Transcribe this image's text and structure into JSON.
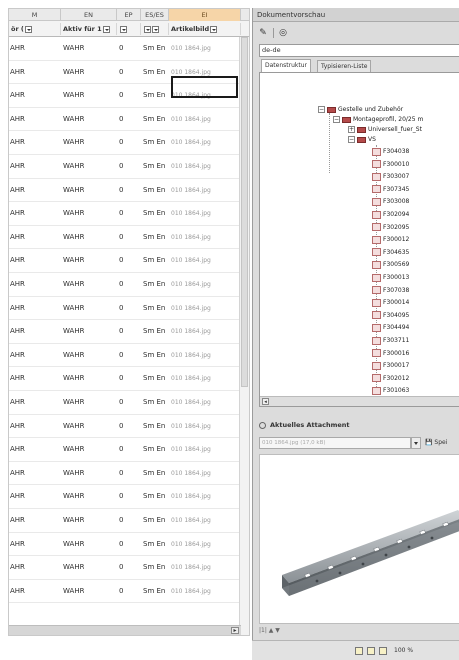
{
  "grid": {
    "header_row1": [
      "M",
      "EN",
      "EP",
      "ES/ES",
      "EI"
    ],
    "header_row2": [
      "ör (",
      "Aktiv für 1",
      "",
      "",
      "Artikelbild"
    ],
    "rows": [
      {
        "c1": "AHR",
        "c2": "WAHR",
        "c3": "0",
        "c4": "Sm En",
        "c5": "010 1864.jpg"
      },
      {
        "c1": "AHR",
        "c2": "WAHR",
        "c3": "0",
        "c4": "Sm En",
        "c5": "010 1864.jpg"
      },
      {
        "c1": "AHR",
        "c2": "WAHR",
        "c3": "0",
        "c4": "Sm En",
        "c5": "010 1864.jpg"
      },
      {
        "c1": "AHR",
        "c2": "WAHR",
        "c3": "0",
        "c4": "Sm En",
        "c5": "010 1864.jpg"
      },
      {
        "c1": "AHR",
        "c2": "WAHR",
        "c3": "0",
        "c4": "Sm En",
        "c5": "010 1864.jpg"
      },
      {
        "c1": "AHR",
        "c2": "WAHR",
        "c3": "0",
        "c4": "Sm En",
        "c5": "010 1864.jpg"
      },
      {
        "c1": "AHR",
        "c2": "WAHR",
        "c3": "0",
        "c4": "Sm En",
        "c5": "010 1864.jpg"
      },
      {
        "c1": "AHR",
        "c2": "WAHR",
        "c3": "0",
        "c4": "Sm En",
        "c5": "010 1864.jpg"
      },
      {
        "c1": "AHR",
        "c2": "WAHR",
        "c3": "0",
        "c4": "Sm En",
        "c5": "010 1864.jpg"
      },
      {
        "c1": "AHR",
        "c2": "WAHR",
        "c3": "0",
        "c4": "Sm En",
        "c5": "010 1864.jpg"
      },
      {
        "c1": "AHR",
        "c2": "WAHR",
        "c3": "0",
        "c4": "Sm En",
        "c5": "010 1864.jpg"
      },
      {
        "c1": "AHR",
        "c2": "WAHR",
        "c3": "0",
        "c4": "Sm En",
        "c5": "010 1864.jpg"
      },
      {
        "c1": "AHR",
        "c2": "WAHR",
        "c3": "0",
        "c4": "Sm En",
        "c5": "010 1864.jpg"
      },
      {
        "c1": "AHR",
        "c2": "WAHR",
        "c3": "0",
        "c4": "Sm En",
        "c5": "010 1864.jpg"
      },
      {
        "c1": "AHR",
        "c2": "WAHR",
        "c3": "0",
        "c4": "Sm En",
        "c5": "010 1864.jpg"
      },
      {
        "c1": "AHR",
        "c2": "WAHR",
        "c3": "0",
        "c4": "Sm En",
        "c5": "010 1864.jpg"
      },
      {
        "c1": "AHR",
        "c2": "WAHR",
        "c3": "0",
        "c4": "Sm En",
        "c5": "010 1864.jpg"
      },
      {
        "c1": "AHR",
        "c2": "WAHR",
        "c3": "0",
        "c4": "Sm En",
        "c5": "010 1864.jpg"
      },
      {
        "c1": "AHR",
        "c2": "WAHR",
        "c3": "0",
        "c4": "Sm En",
        "c5": "010 1864.jpg"
      },
      {
        "c1": "AHR",
        "c2": "WAHR",
        "c3": "0",
        "c4": "Sm En",
        "c5": "010 1864.jpg"
      },
      {
        "c1": "AHR",
        "c2": "WAHR",
        "c3": "0",
        "c4": "Sm En",
        "c5": "010 1864.jpg"
      },
      {
        "c1": "AHR",
        "c2": "WAHR",
        "c3": "0",
        "c4": "Sm En",
        "c5": "010 1864.jpg"
      },
      {
        "c1": "AHR",
        "c2": "WAHR",
        "c3": "0",
        "c4": "Sm En",
        "c5": "010 1864.jpg"
      },
      {
        "c1": "AHR",
        "c2": "WAHR",
        "c3": "0",
        "c4": "Sm En",
        "c5": "010 1864.jpg"
      }
    ]
  },
  "right_panel": {
    "title": "Dokumentvorschau",
    "locale": "de-de",
    "tabs": [
      "Datenstruktur",
      "Typisieren-Liste"
    ],
    "tree": {
      "root": "Gestelle und Zubehör",
      "child": "Montageprofil, 20/25 m",
      "sub1": "Universell_fuer_St",
      "sub2": "VS",
      "files": [
        "F304038",
        "F300010",
        "F303007",
        "F307345",
        "F303008",
        "F302094",
        "F302095",
        "F300012",
        "F304635",
        "F300569",
        "F300013",
        "F307038",
        "F300014",
        "F304095",
        "F304494",
        "F303711",
        "F300016",
        "F300017",
        "F302012",
        "F301063"
      ]
    },
    "attachment_header": "Aktuelles Attachment",
    "attachment_file": "010 1864.jpg (17,0 kB)",
    "attachment_save": "Spei",
    "preview_nav": "|1| ▲ ▼",
    "status_zoom": "100 %"
  },
  "colors": {
    "accent_header": "#f6d5a8",
    "folder": "#b44a4a",
    "doc": "#f4dede"
  }
}
